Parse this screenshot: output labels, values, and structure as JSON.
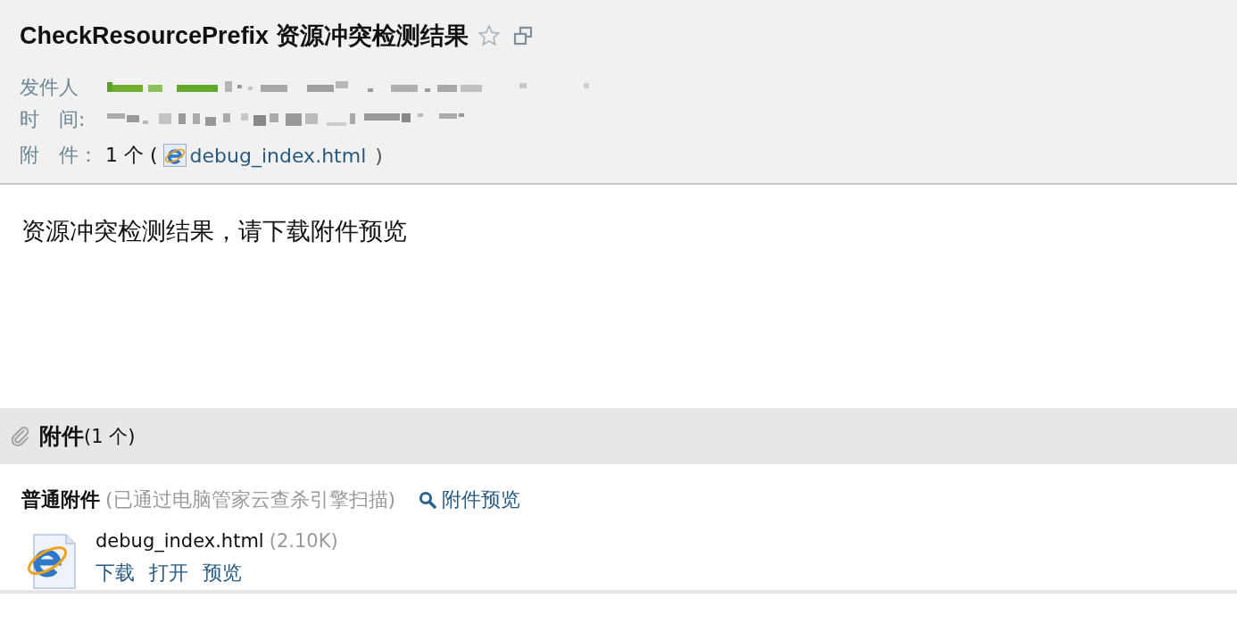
{
  "header": {
    "title": "CheckResourcePrefix 资源冲突检测结果",
    "starred": false,
    "fields": [
      {
        "label": "发件人",
        "kind": "redacted"
      },
      {
        "label": "时　间:",
        "kind": "redacted"
      },
      {
        "label": "附　件：",
        "kind": "attachment",
        "count": "1 个 (",
        "link": "debug_index.html",
        "close": ")"
      }
    ]
  },
  "body": {
    "text": "资源冲突检测结果，请下载附件预览"
  },
  "attachments": {
    "title": "附件",
    "count": "(1 个)",
    "group_label": "普通附件",
    "scan_note": "(已通过电脑管家云查杀引擎扫描)",
    "preview_link": "附件预览",
    "files": [
      {
        "name": "debug_index.html",
        "size": "(2.10K)",
        "actions": [
          "下载",
          "打开",
          "预览"
        ]
      }
    ]
  }
}
